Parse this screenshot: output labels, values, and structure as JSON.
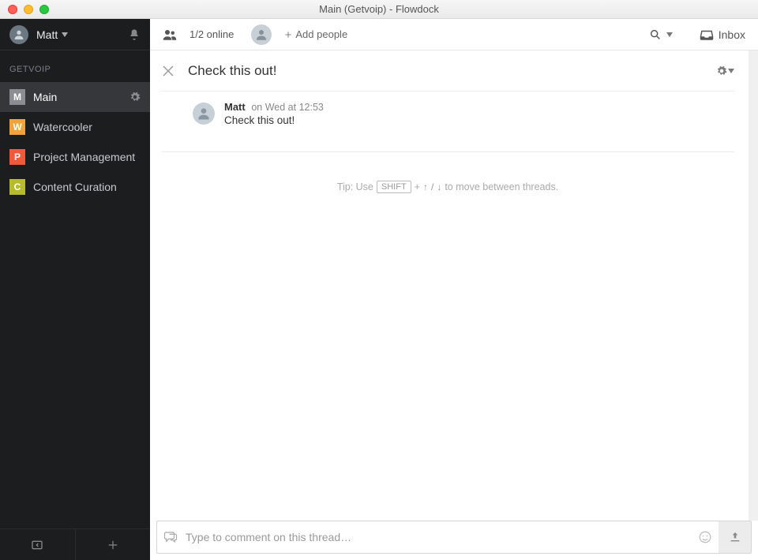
{
  "window": {
    "title": "Main (Getvoip) - Flowdock"
  },
  "sidebar": {
    "user": {
      "name": "Matt"
    },
    "org": "GETVOIP",
    "channels": [
      {
        "key": "M",
        "label": "Main",
        "active": true,
        "gear": true
      },
      {
        "key": "W",
        "label": "Watercooler"
      },
      {
        "key": "P",
        "label": "Project Management"
      },
      {
        "key": "C",
        "label": "Content Curation"
      }
    ]
  },
  "topbar": {
    "online": "1/2 online",
    "add_people": "Add people",
    "inbox": "Inbox"
  },
  "thread": {
    "title": "Check this out!",
    "message": {
      "author": "Matt",
      "time": "on Wed at 12:53",
      "body": "Check this out!"
    },
    "tip_prefix": "Tip: Use",
    "tip_shift": "SHIFT",
    "tip_plus": "+",
    "tip_sep": "/",
    "tip_suffix": "to move between threads."
  },
  "composer": {
    "placeholder": "Type to comment on this thread…"
  }
}
